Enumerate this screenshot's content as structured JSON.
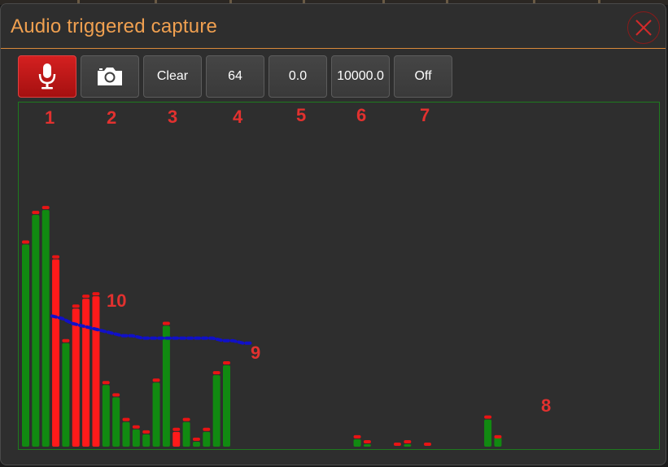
{
  "window": {
    "title": "Audio triggered capture"
  },
  "icons": {
    "close": "close-icon",
    "microphone": "microphone-icon",
    "camera": "camera-icon"
  },
  "toolbar": {
    "buttons": [
      {
        "id": "mic",
        "icon": "microphone-icon",
        "active": true
      },
      {
        "id": "capture",
        "icon": "camera-icon"
      },
      {
        "id": "clear",
        "label": "Clear"
      },
      {
        "id": "bands",
        "label": "64"
      },
      {
        "id": "min",
        "label": "0.0"
      },
      {
        "id": "max",
        "label": "10000.0"
      },
      {
        "id": "mode",
        "label": "Off"
      }
    ]
  },
  "callouts": [
    "1",
    "2",
    "3",
    "4",
    "5",
    "6",
    "7",
    "8",
    "9",
    "10"
  ],
  "colors": {
    "accent": "#f0a050",
    "active": "#c81818",
    "bar_below": "#118a11",
    "bar_above": "#ff1a1a",
    "peak": "#e81414",
    "threshold": "#1010c8",
    "plot_border": "#1e7a1e",
    "callout": "#e2312f"
  },
  "chart_data": {
    "type": "bar",
    "ylim": [
      0,
      100
    ],
    "bands": 64,
    "values": [
      82,
      94,
      96,
      76,
      42,
      56,
      60,
      61,
      25,
      20,
      10,
      7,
      5,
      26,
      49,
      6,
      10,
      2,
      6,
      29,
      33,
      0,
      0,
      0,
      0,
      0,
      0,
      0,
      0,
      0,
      0,
      0,
      0,
      0,
      0,
      0,
      0,
      0,
      0,
      0,
      0,
      0,
      0,
      0,
      0,
      0,
      0,
      0,
      0,
      0,
      0,
      0,
      0,
      0,
      0,
      0,
      0,
      0,
      0,
      0,
      0,
      0,
      0,
      0
    ],
    "peaks": [
      83,
      95,
      97,
      77,
      43,
      57,
      61,
      62,
      26,
      21,
      11,
      8,
      6,
      27,
      50,
      7,
      11,
      3,
      7,
      30,
      34,
      0,
      0,
      0,
      0,
      0,
      0,
      0,
      0,
      0,
      0,
      0,
      0,
      4,
      2,
      0,
      0,
      1,
      2,
      0,
      0,
      0,
      0,
      0,
      0,
      0,
      12,
      4,
      0,
      0,
      0,
      0,
      0,
      0,
      0,
      0,
      0,
      0,
      0,
      0,
      0,
      0,
      0,
      0
    ],
    "overlay_values": {
      "33": 3,
      "34": 1,
      "37": 0,
      "38": 1,
      "40": 0,
      "46": 11,
      "47": 4
    },
    "threshold": [
      53,
      52,
      50,
      49,
      48,
      47,
      46,
      45,
      45,
      44,
      44,
      44,
      44,
      44,
      44,
      44,
      44,
      43,
      43,
      42,
      42
    ],
    "above_threshold": [
      3,
      5,
      6,
      7,
      15
    ]
  }
}
